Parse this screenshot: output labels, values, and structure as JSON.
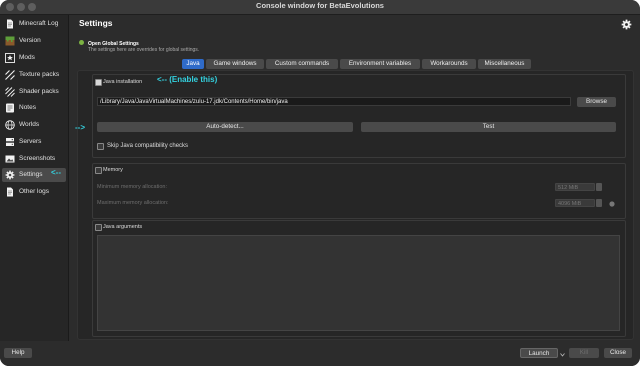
{
  "window": {
    "title": "Console window for BetaEvolutions"
  },
  "sidebar": {
    "items": [
      {
        "label": "Minecraft Log",
        "icon": "log-file-icon"
      },
      {
        "label": "Version",
        "icon": "grass-block-icon"
      },
      {
        "label": "Mods",
        "icon": "star-box-icon"
      },
      {
        "label": "Texture packs",
        "icon": "texture-pack-icon"
      },
      {
        "label": "Shader packs",
        "icon": "shader-pack-icon"
      },
      {
        "label": "Notes",
        "icon": "notes-icon"
      },
      {
        "label": "Worlds",
        "icon": "globe-icon"
      },
      {
        "label": "Servers",
        "icon": "server-icon"
      },
      {
        "label": "Screenshots",
        "icon": "screenshot-icon"
      },
      {
        "label": "Settings",
        "icon": "gear-icon"
      },
      {
        "label": "Other logs",
        "icon": "other-logs-icon"
      }
    ],
    "active": "Settings"
  },
  "main": {
    "title": "Settings",
    "hint_title": "Open Global Settings",
    "hint_desc": "The settings here are overrides for global settings.",
    "tabs": [
      "Java",
      "Game windows",
      "Custom commands",
      "Environment variables",
      "Workarounds",
      "Miscellaneous"
    ],
    "active_tab": "Java"
  },
  "java_installation": {
    "label": "Java installation",
    "checked": true,
    "path": "/Library/Java/JavaVirtualMachines/zulu-17.jdk/Contents/Home/bin/java",
    "browse_label": "Browse",
    "autodetect_label": "Auto-detect...",
    "test_label": "Test",
    "skip_checks_label": "Skip Java compatibility checks"
  },
  "memory": {
    "label": "Memory",
    "min_label": "Minimum memory allocation:",
    "min_value": "512 MiB",
    "max_label": "Maximum memory allocation:",
    "max_value": "4096 MiB"
  },
  "java_arguments": {
    "label": "Java arguments"
  },
  "annotations": {
    "enable_note": "<-- (Enable this)",
    "arrow_left": "<--",
    "arrow_right": "-->"
  },
  "footer": {
    "help": "Help",
    "launch": "Launch",
    "kill": "Kill",
    "close": "Close"
  },
  "colors": {
    "accent": "#2f6bc9",
    "annotation": "#34d2e0",
    "status_green": "#7cb342"
  }
}
